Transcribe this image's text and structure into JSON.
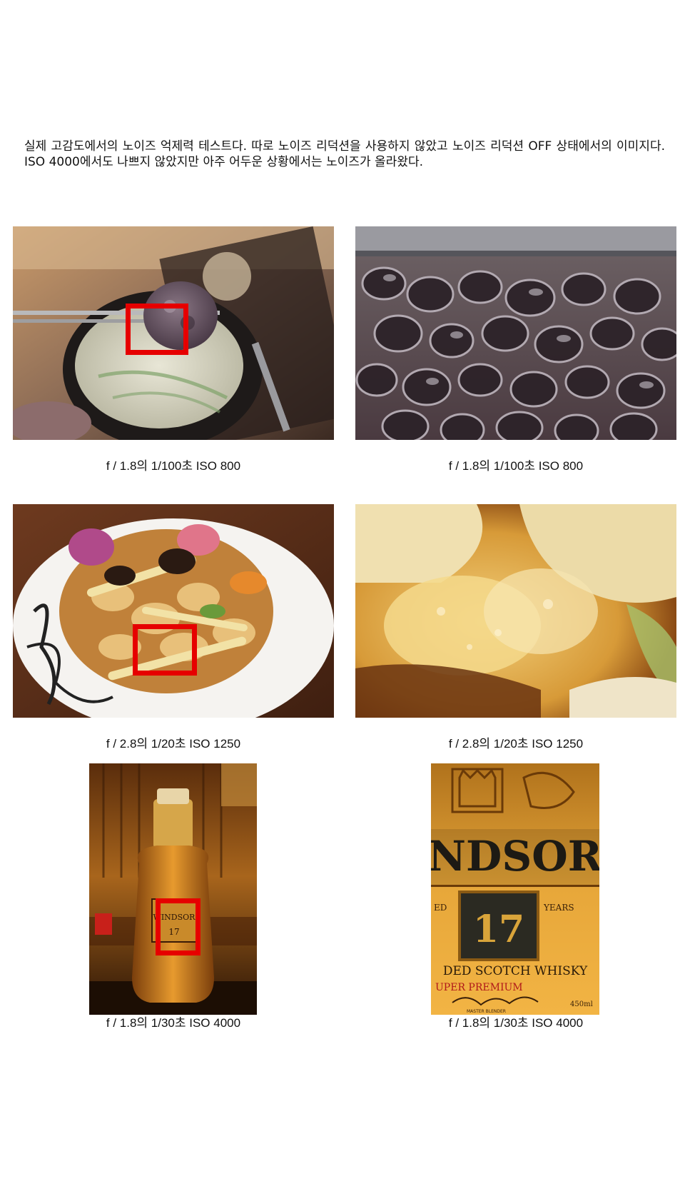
{
  "intro_text": "실제 고감도에서의 노이즈 억제력 테스트다. 따로 노이즈 리덕션을 사용하지 않았고 노이즈 리덕션 OFF 상태에서의 이미지다. ISO 4000에서도 나쁘지 않았지만 아주 어두운 상황에서는 노이즈가 올라왔다.",
  "rows": [
    {
      "left_caption": "f / 1.8의 1/100초 ISO 800",
      "right_caption": "f / 1.8의 1/100초 ISO 800"
    },
    {
      "left_caption": "f / 2.8의 1/20초 ISO 1250",
      "right_caption": "f / 2.8의 1/20초 ISO 1250"
    },
    {
      "left_caption": "f / 1.8의 1/30초 ISO 4000",
      "right_caption": "f / 1.8의 1/30초 ISO 4000"
    }
  ],
  "whisky_label": {
    "brand": "NDSOR",
    "brand_small": "WINDSOR",
    "age": "17",
    "age_left": "ED",
    "age_right": "YEARS",
    "line1": "DED SCOTCH WHISKY",
    "line2": "UPER PREMIUM",
    "volume": "450ml",
    "blender": "MASTER BLENDER"
  },
  "colors": {
    "highlight": "#e60000"
  }
}
